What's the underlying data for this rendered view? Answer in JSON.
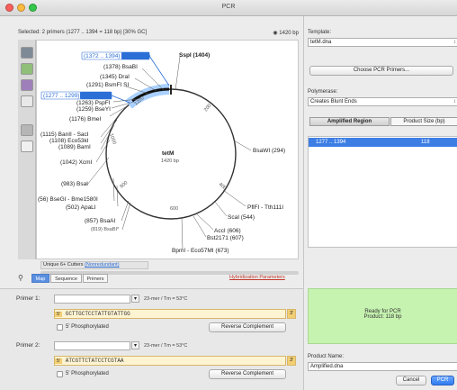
{
  "window": {
    "title": "PCR"
  },
  "map": {
    "selection_info": "Selected: 2 primers (1277 .. 1394 = 118 bp) [30% GC]",
    "length_label": "1420 bp",
    "plasmid_name": "tetM",
    "plasmid_size": "1420 bp",
    "ticks": [
      "200",
      "400",
      "600",
      "800",
      "1000",
      "1200"
    ],
    "primer2_label": "(1372 .. 1394) <Primer 2>",
    "primer1_label": "(1277 .. 1299) <Primer 1>",
    "features": [
      "SspI (1404)",
      "(1378) BsaBI",
      "(1345) DraI",
      "(1291) BsmFI SI",
      "(1263) PspFI",
      "(1259) BseYI",
      "(1176) BmeI",
      "(1115) BanII - SacI",
      "(1108) Eco53kI",
      "(1089) BamI",
      "(1042) XcmI",
      "(983) BsaI",
      "(56) BseGI - Bme1580I",
      "(502) ApaLI",
      "(857) BsaAI",
      "(819) BsaBI*",
      "BsaWI (294)",
      "PflFI - Tth111I",
      "ScaI (544)",
      "AccI (606)",
      "Bst2171 (607)",
      "BpmI - Eco57MI (673)"
    ]
  },
  "toolbar": {
    "enzyme_text": "Unique 6+ Cutters",
    "enzyme_link": "(Nonredundant)",
    "tabs": [
      "Map",
      "Sequence",
      "Primers"
    ],
    "hybridization_link": "Hybridization Parameters"
  },
  "primer1": {
    "label": "Primer 1:",
    "name": "",
    "meta": "23-mer / Tm = 53°C",
    "end5": "5'",
    "sequence": "GCTTGCTCCTATTGTATTGG",
    "end3": "3'",
    "phos_label": "5' Phosphorylated",
    "revcomp_label": "Reverse Complement"
  },
  "primer2": {
    "label": "Primer 2:",
    "name": "",
    "meta": "23-mer / Tm = 53°C",
    "end5": "5'",
    "sequence": "ATCGTTCTATCCTCGTAA",
    "end3": "3'",
    "phos_label": "5' Phosphorylated",
    "revcomp_label": "Reverse Complement"
  },
  "right": {
    "template_label": "Template:",
    "template_value": "tetM.dna",
    "choose_primers": "Choose PCR Primers...",
    "polymerase_label": "Polymerase:",
    "polymerase_value": "Creates Blunt Ends",
    "seg_amplified": "Amplified Region",
    "seg_product": "Product Size (bp)",
    "region_range": "1277 .. 1394",
    "region_size": "118",
    "ready_line1": "Ready for PCR",
    "ready_line2": "Product:  118 bp",
    "product_name_label": "Product Name:",
    "product_name_value": "Amplified.dna",
    "cancel": "Cancel",
    "pcr": "PCR"
  },
  "colors": {
    "accent": "#3d7ee5",
    "ready_bg": "#c6f3b0",
    "primer_seq_bg": "#fff4d2",
    "primer_highlight": "#aad0ff"
  }
}
